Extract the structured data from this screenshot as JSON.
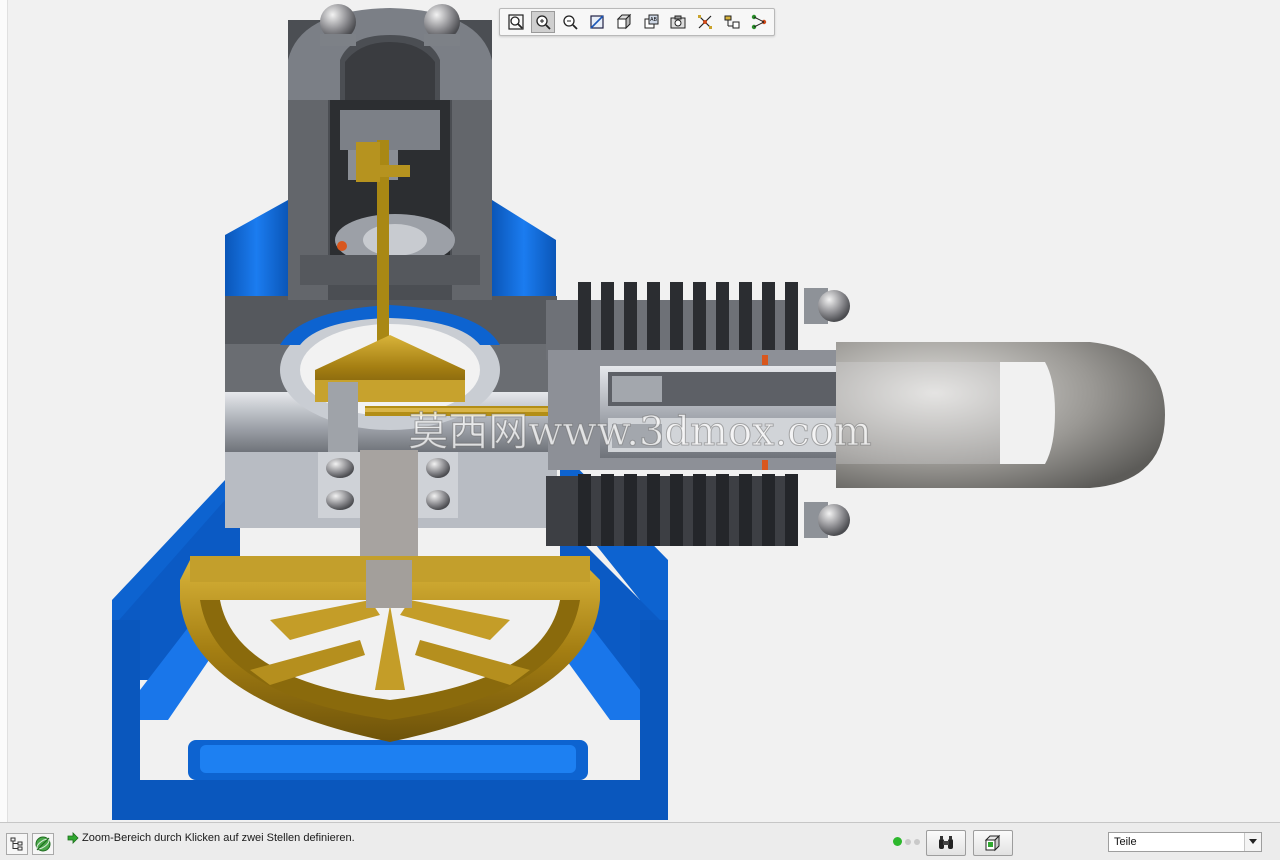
{
  "toolbar": {
    "buttons": [
      {
        "name": "zoom-fit",
        "icon": "zoom-fit-icon",
        "active": false
      },
      {
        "name": "zoom-area",
        "icon": "zoom-area-icon",
        "active": true
      },
      {
        "name": "zoom-out",
        "icon": "zoom-out-icon",
        "active": false
      },
      {
        "name": "section-view",
        "icon": "section-view-icon",
        "active": false
      },
      {
        "name": "view-orientation",
        "icon": "cube-view-icon",
        "active": false
      },
      {
        "name": "display-style",
        "icon": "display-style-icon",
        "active": false
      },
      {
        "name": "snapshot",
        "icon": "camera-icon",
        "active": false
      },
      {
        "name": "explode",
        "icon": "explode-icon",
        "active": false
      },
      {
        "name": "measure",
        "icon": "measure-icon",
        "active": false
      },
      {
        "name": "tree-connect",
        "icon": "tree-connect-icon",
        "active": false
      }
    ]
  },
  "watermark": {
    "text": "莫西网www.3dmox.com"
  },
  "statusbar": {
    "hint": "Zoom-Bereich durch Klicken auf zwei Stellen definieren.",
    "filter_value": "Teile",
    "status_color": "#2db82d"
  },
  "colors": {
    "frame_blue": "#0f6fe0",
    "brass": "#b8901a",
    "steel_dark": "#4f5256",
    "steel_light": "#b8bcc2",
    "fin_dark": "#2a2c30"
  }
}
